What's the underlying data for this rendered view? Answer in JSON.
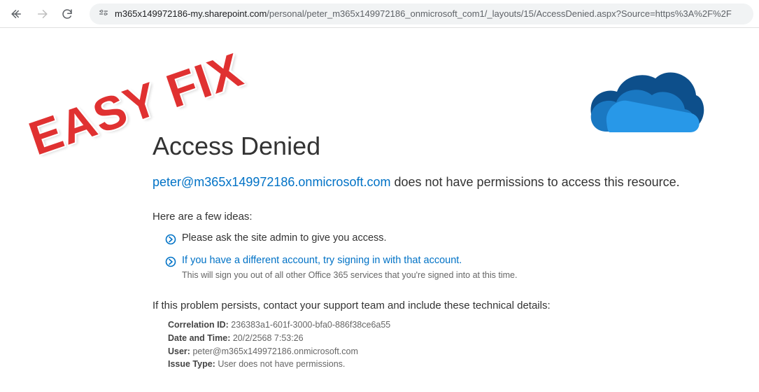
{
  "browser": {
    "url_host": "m365x149972186-my.sharepoint.com",
    "url_path": "/personal/peter_m365x149972186_onmicrosoft_com1/_layouts/15/AccessDenied.aspx?Source=https%3A%2F%2F"
  },
  "overlay": {
    "easy_fix": "EASY FIX"
  },
  "page": {
    "title": "Access Denied",
    "email": "peter@m365x149972186.onmicrosoft.com",
    "no_perm_suffix": " does not have permissions to access this resource.",
    "ideas_head": "Here are a few ideas:",
    "idea1": "Please ask the site admin to give you access.",
    "idea2_link": "If you have a different account, try signing in with that account.",
    "idea2_sub": "This will sign you out of all other Office 365 services that you're signed into at this time.",
    "persist": "If this problem persists, contact your support team and include these technical details:",
    "tech": {
      "corr_label": "Correlation ID:",
      "corr_val": " 236383a1-601f-3000-bfa0-886f38ce6a55",
      "date_label": "Date and Time:",
      "date_val": " 20/2/2568 7:53:26",
      "user_label": "User:",
      "user_val": " peter@m365x149972186.onmicrosoft.com",
      "issue_label": "Issue Type:",
      "issue_val": " User does not have permissions."
    }
  }
}
